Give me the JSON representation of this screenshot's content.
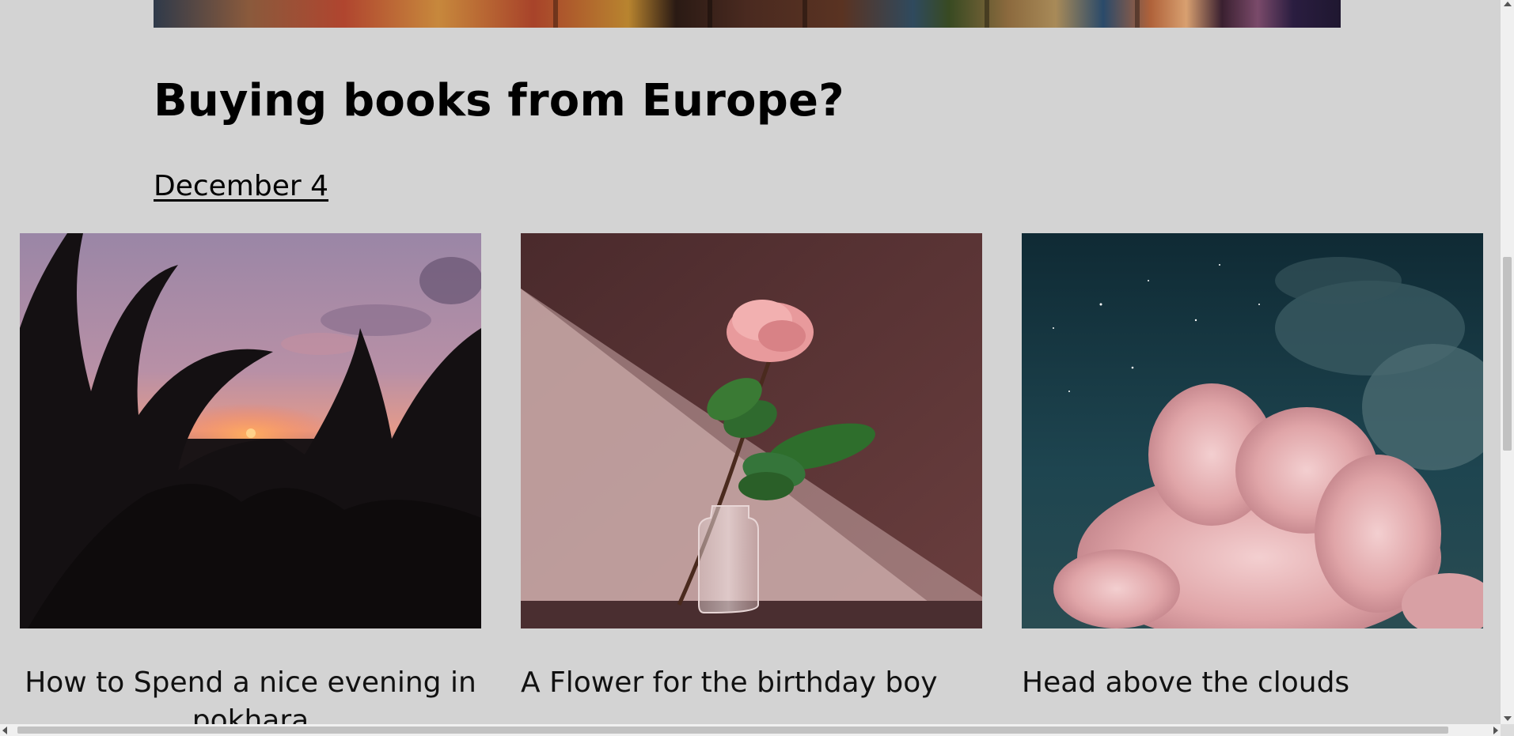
{
  "post": {
    "title": "Buying books from Europe?",
    "date": "December 4"
  },
  "cards": [
    {
      "title": "How to Spend a nice evening in pokhara",
      "image_icon": "palm-sunset-image"
    },
    {
      "title": "A Flower for the birthday boy",
      "image_icon": "rose-vase-image"
    },
    {
      "title": "Head above the clouds",
      "image_icon": "night-clouds-image"
    }
  ],
  "colors": {
    "background": "#d3d3d3",
    "text": "#000000"
  }
}
